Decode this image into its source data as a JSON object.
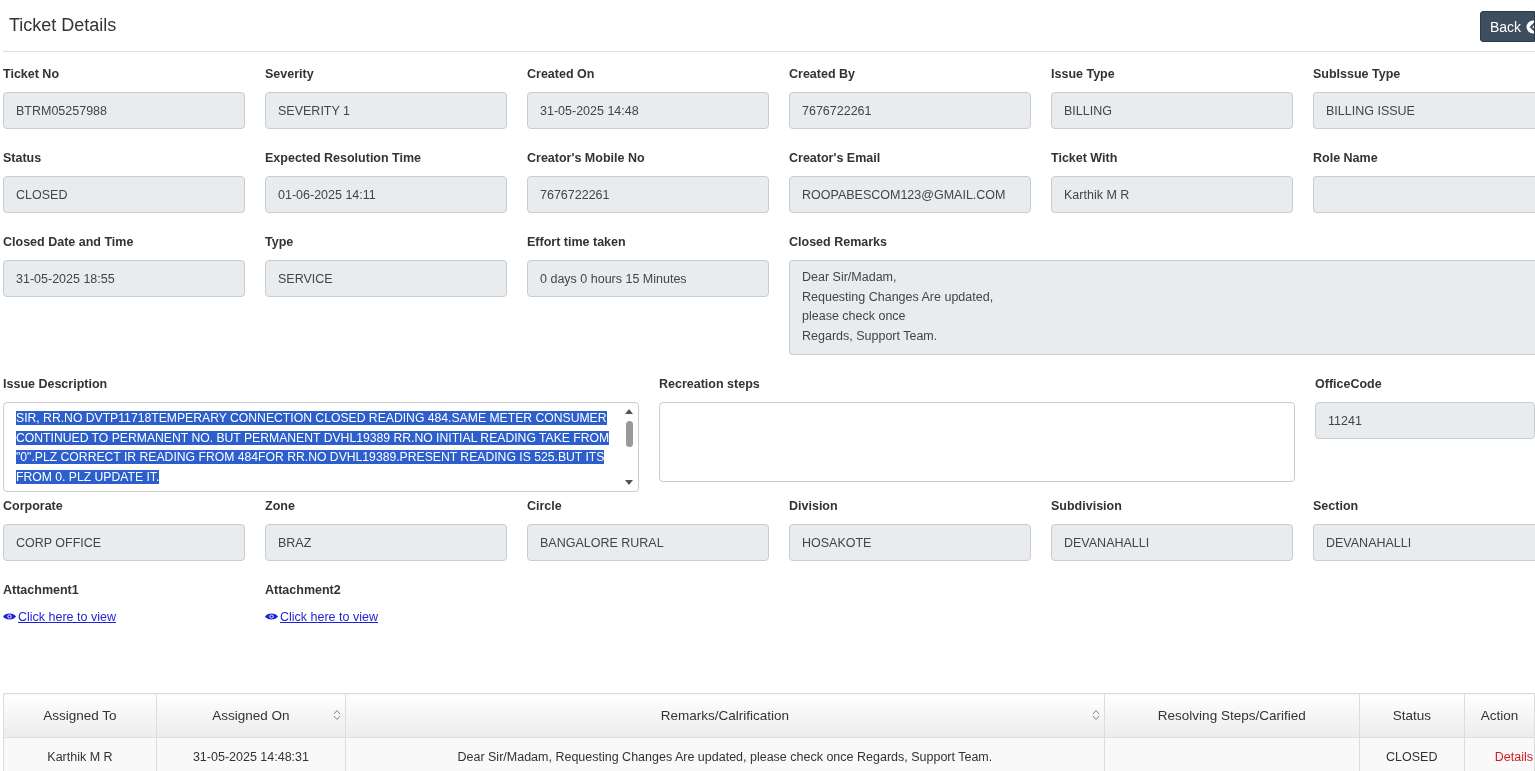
{
  "header": {
    "title": "Ticket Details",
    "back_button": "Back"
  },
  "field_rows": [
    [
      {
        "label": "Ticket No",
        "value": "BTRM05257988",
        "kind": "input"
      },
      {
        "label": "Severity",
        "value": "SEVERITY 1",
        "kind": "input"
      },
      {
        "label": "Created On",
        "value": "31-05-2025 14:48",
        "kind": "input"
      },
      {
        "label": "Created By",
        "value": "7676722261",
        "kind": "input"
      },
      {
        "label": "Issue Type",
        "value": "BILLING",
        "kind": "input"
      },
      {
        "label": "SubIssue Type",
        "value": "BILLING ISSUE",
        "kind": "input"
      }
    ],
    [
      {
        "label": "Status",
        "value": "CLOSED",
        "kind": "input"
      },
      {
        "label": "Expected Resolution Time",
        "value": "01-06-2025 14:11",
        "kind": "input"
      },
      {
        "label": "Creator's Mobile No",
        "value": "7676722261",
        "kind": "input"
      },
      {
        "label": "Creator's Email",
        "value": "ROOPABESCOM123@GMAIL.COM",
        "kind": "input"
      },
      {
        "label": "Ticket With",
        "value": "Karthik M R",
        "kind": "input"
      },
      {
        "label": "Role Name",
        "kind": "input"
      }
    ],
    [
      {
        "label": "Closed Date and Time",
        "value": "31-05-2025 18:55",
        "kind": "input"
      },
      {
        "label": "Type",
        "value": "SERVICE",
        "kind": "input"
      },
      {
        "label": "Effort time taken",
        "value": "0 days 0 hours 15 Minutes",
        "kind": "input"
      },
      {
        "label": "Closed Remarks",
        "lines": [
          "Dear Sir/Madam,",
          "Requesting Changes Are updated,",
          "please check once",
          "Regards, Support Team."
        ],
        "kind": "textarea"
      }
    ],
    [
      {
        "label": "Issue Description",
        "lines": [
          "SIR, RR.NO DVTP11718TEMPERARY CONNECTION  CLOSED READING 484.SAME METER  CONSUMER CONTINUED TO PERMANENT NO. BUT PERMANENT DVHL19389 RR.NO INITIAL READING TAKE FROM \"0\".PLZ CORRECT IR READING FROM 484FOR RR.NO DVHL19389.PRESENT READING IS 525.BUT ITS FROM 0. PLZ UPDATE IT."
        ],
        "kind": "textarea",
        "selected": true
      },
      {
        "label": "Recreation steps",
        "kind": "textarea"
      },
      {
        "label": "OfficeCode",
        "value": "11241",
        "kind": "input"
      }
    ],
    [
      {
        "label": "Corporate",
        "value": "CORP OFFICE",
        "kind": "input"
      },
      {
        "label": "Zone",
        "value": "BRAZ",
        "kind": "input"
      },
      {
        "label": "Circle",
        "value": "BANGALORE RURAL",
        "kind": "input"
      },
      {
        "label": "Division",
        "value": "HOSAKOTE",
        "kind": "input"
      },
      {
        "label": "Subdivision",
        "value": "DEVANAHALLI",
        "kind": "input"
      },
      {
        "label": "Section",
        "value": "DEVANAHALLI",
        "kind": "input"
      }
    ]
  ],
  "attachments": [
    {
      "label": "Attachment1",
      "link": "Click here to view"
    },
    {
      "label": "Attachment2",
      "link": "Click here to view"
    }
  ],
  "table": {
    "columns": [
      {
        "label": "Assigned To",
        "sortable": false
      },
      {
        "label": "Assigned On",
        "sortable": true
      },
      {
        "label": "Remarks/Calrification",
        "sortable": true
      },
      {
        "label": "Resolving Steps/Carified",
        "sortable": false
      },
      {
        "label": "Status",
        "sortable": false
      },
      {
        "label": "Action",
        "sortable": false
      }
    ],
    "rows": [
      {
        "cells": [
          "Karthik M R",
          "31-05-2025 14:48:31",
          "Dear Sir/Madam, Requesting Changes Are updated, please check once Regards, Support Team.",
          "",
          "CLOSED"
        ],
        "action": "Details"
      }
    ]
  }
}
